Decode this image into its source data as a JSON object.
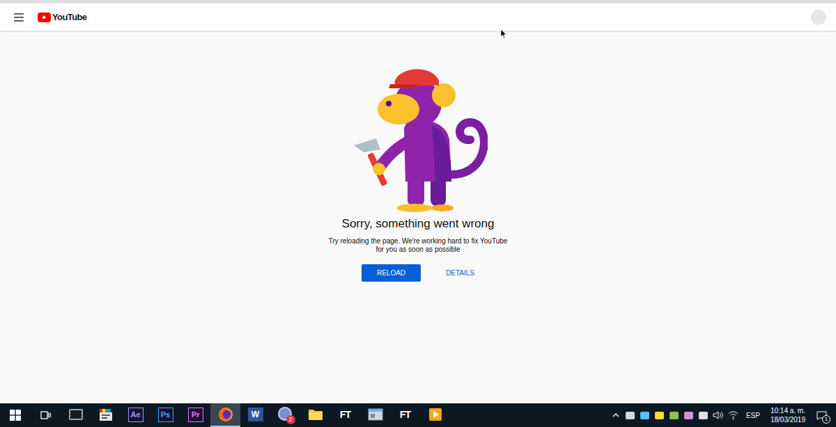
{
  "header": {
    "logo": "YouTube"
  },
  "error": {
    "title": "Sorry, something went wrong",
    "message_lines": [
      "Try reloading the page. We're working hard to fix YouTube",
      "for you as soon as possible"
    ],
    "buttons": [
      {
        "label": "RELOAD",
        "kind": "primary"
      },
      {
        "label": "DETAILS",
        "kind": "link"
      }
    ]
  },
  "taskbar": {
    "apps": [
      {
        "kind": "terminal",
        "selected": false
      },
      {
        "kind": "clapper",
        "selected": false
      },
      {
        "kind": "adobe",
        "label": "Ae",
        "color": "#9999ff",
        "selected": false
      },
      {
        "kind": "adobe",
        "label": "Ps",
        "color": "#31a8ff",
        "selected": false
      },
      {
        "kind": "adobe",
        "label": "Pr",
        "color": "#ea77ff",
        "selected": false
      },
      {
        "kind": "firefox",
        "selected": true
      },
      {
        "kind": "word",
        "label": "W",
        "selected": false
      },
      {
        "kind": "chat",
        "badge": "2",
        "selected": false
      },
      {
        "kind": "folder",
        "selected": false
      },
      {
        "kind": "ft",
        "label": "FT",
        "selected": false
      },
      {
        "kind": "window",
        "selected": false
      },
      {
        "kind": "ft",
        "label": "FT",
        "selected": false
      },
      {
        "kind": "player",
        "selected": false
      }
    ],
    "tray": {
      "language": "ESP",
      "time": "10:14 a. m.",
      "date": "18/03/2019",
      "notifications": "1"
    }
  }
}
